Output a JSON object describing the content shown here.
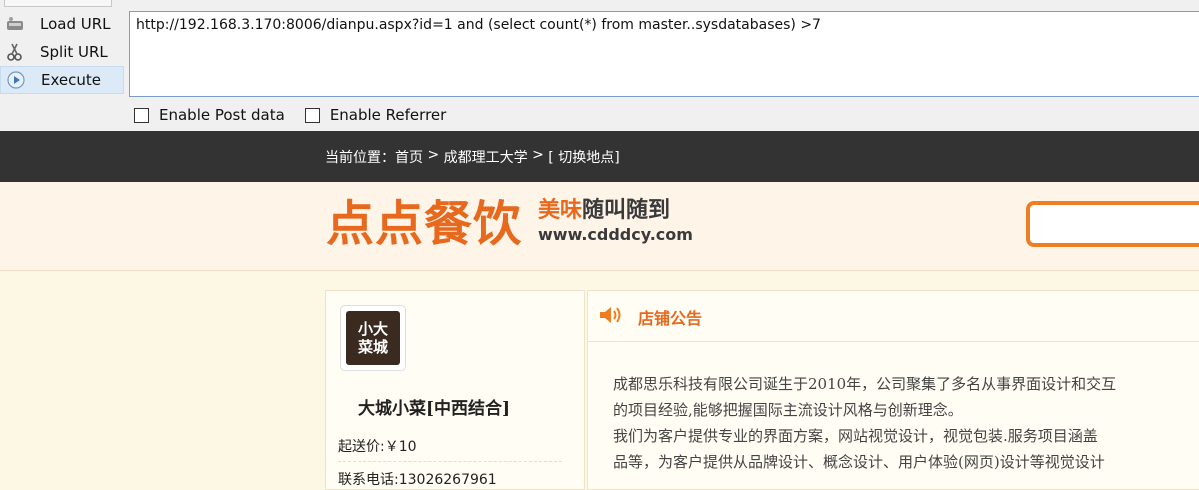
{
  "hackbar": {
    "menu": [
      {
        "label": "Load URL",
        "icon": "load-url-icon"
      },
      {
        "label": "Split URL",
        "icon": "split-url-icon"
      },
      {
        "label": "Execute",
        "icon": "execute-icon"
      }
    ],
    "url_value": "http://192.168.3.170:8006/dianpu.aspx?id=1 and (select count(*) from master..sysdatabases) >7",
    "enable_post": "Enable Post data",
    "enable_referrer": "Enable Referrer"
  },
  "site": {
    "breadcrumb": {
      "prefix": "当前位置：",
      "home": "首页",
      "sep1": " > ",
      "school": "成都理工大学",
      "sep2": " > ",
      "switch": "[ 切换地点]"
    },
    "logo": {
      "name": "点点餐饮",
      "slogan_a": "美味",
      "slogan_b": "随叫随到",
      "domain": "www.cdddcy.com"
    },
    "store": {
      "logo_text_1": "小大",
      "logo_text_2": "菜城",
      "name": "大城小菜[中西结合]",
      "min_order": "起送价:￥10",
      "phone": "联系电话:13026267961"
    },
    "notice": {
      "title": "店铺公告",
      "lines": [
        "成都思乐科技有限公司诞生于2010年，公司聚集了多名从事界面设计和交互",
        "的项目经验,能够把握国际主流设计风格与创新理念。",
        "我们为客户提供专业的界面方案，网站视觉设计，视觉包装.服务项目涵盖",
        "品等，为客户提供从品牌设计、概念设计、用户体验(网页)设计等视觉设计"
      ]
    }
  },
  "colors": {
    "accent": "#e6691e",
    "topbar": "#333333",
    "page_bg": "#fdf8e3"
  }
}
